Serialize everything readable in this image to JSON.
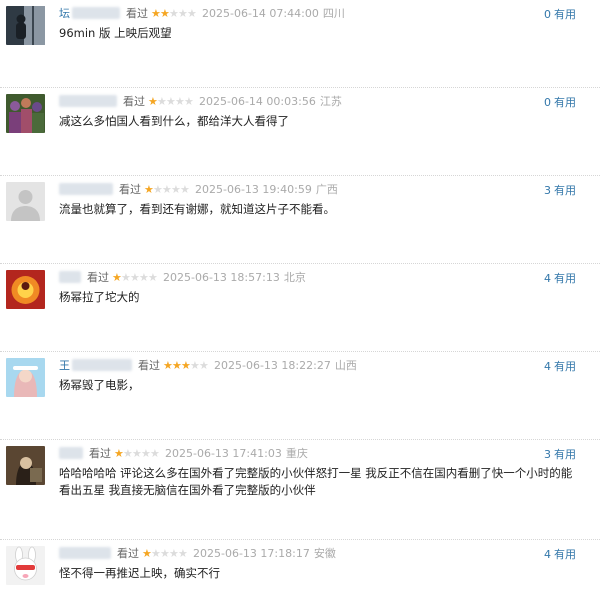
{
  "comments": [
    {
      "user_visible": "坛",
      "status": "看过",
      "rating": 2,
      "time": "2025-06-14 07:44:00",
      "location": "四川",
      "useful_count": "0",
      "useful_label": "有用",
      "text": "96min 版 上映后观望",
      "avatar_icon": "silhouette-window-avatar",
      "avatar_colors": [
        "#2f3a44",
        "#8b97a3"
      ]
    },
    {
      "user_visible": "",
      "status": "看过",
      "rating": 1,
      "time": "2025-06-14 00:03:56",
      "location": "江苏",
      "useful_count": "0",
      "useful_label": "有用",
      "text": "减这么多怕国人看到什么，都给洋大人看得了",
      "avatar_icon": "group-photo-avatar",
      "avatar_colors": [
        "#3f5a2e",
        "#8a5a9a"
      ]
    },
    {
      "user_visible": "",
      "status": "看过",
      "rating": 1,
      "time": "2025-06-13 19:40:59",
      "location": "广西",
      "useful_count": "3",
      "useful_label": "有用",
      "text": "流量也就算了，看到还有谢娜，就知道这片子不能看。",
      "avatar_icon": "default-user-avatar",
      "avatar_colors": [
        "#e4e4e4",
        "#c4c4c4"
      ]
    },
    {
      "user_visible": "",
      "status": "看过",
      "rating": 1,
      "time": "2025-06-13 18:57:13",
      "location": "北京",
      "useful_count": "4",
      "useful_label": "有用",
      "text": "杨幂拉了坨大的",
      "avatar_icon": "fire-portrait-avatar",
      "avatar_colors": [
        "#b3261e",
        "#f08a24"
      ]
    },
    {
      "user_visible": "王",
      "status": "看过",
      "rating": 3,
      "time": "2025-06-13 18:22:27",
      "location": "山西",
      "useful_count": "4",
      "useful_label": "有用",
      "text": "杨幂毁了电影，",
      "avatar_icon": "girl-portrait-avatar",
      "avatar_colors": [
        "#a8d8ef",
        "#f4c7c3"
      ]
    },
    {
      "user_visible": "",
      "status": "看过",
      "rating": 1,
      "time": "2025-06-13 17:41:03",
      "location": "重庆",
      "useful_count": "3",
      "useful_label": "有用",
      "text": "哈哈哈哈哈 评论这么多在国外看了完整版的小伙伴怒打一星 我反正不信在国内看删了快一个小时的能看出五星 我直接无脑信在国外看了完整版的小伙伴",
      "avatar_icon": "woman-portrait-avatar",
      "avatar_colors": [
        "#5a4632",
        "#d8c0a0"
      ]
    },
    {
      "user_visible": "",
      "status": "看过",
      "rating": 1,
      "time": "2025-06-13 17:18:17",
      "location": "安徽",
      "useful_count": "4",
      "useful_label": "有用",
      "text": "怪不得一再推迟上映，确实不行",
      "avatar_icon": "cartoon-rabbit-avatar",
      "avatar_colors": [
        "#ffffff",
        "#e23b3b"
      ]
    }
  ]
}
